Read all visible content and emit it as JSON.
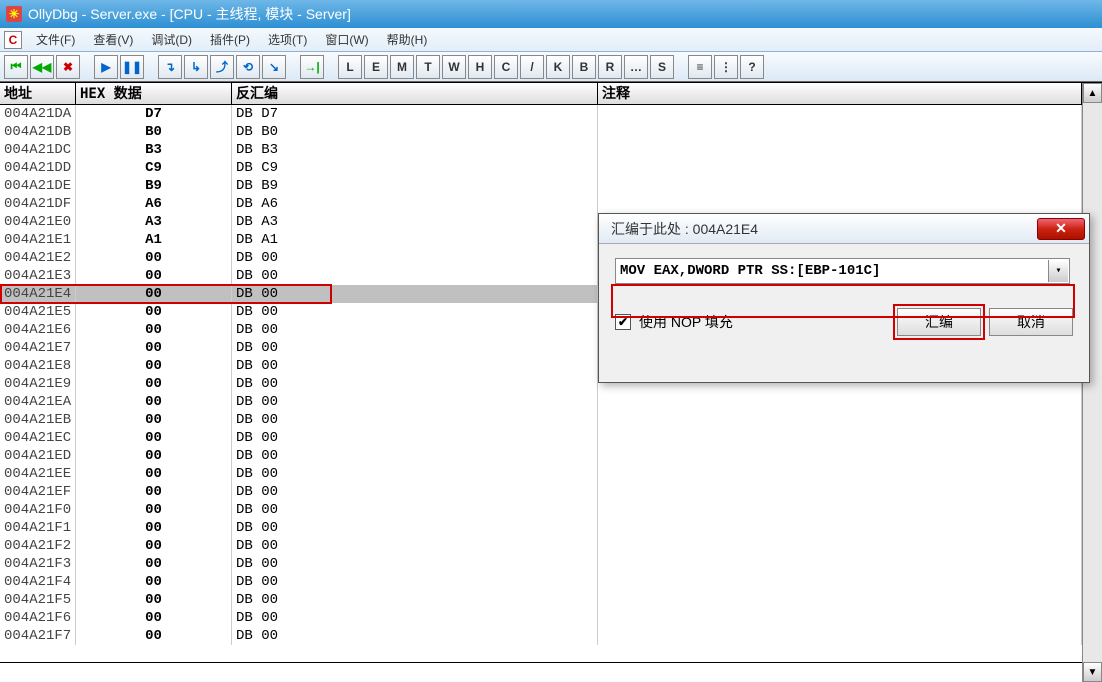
{
  "window": {
    "title": "OllyDbg - Server.exe - [CPU - 主线程, 模块 - Server]"
  },
  "menu": {
    "items": [
      "文件(F)",
      "查看(V)",
      "调试(D)",
      "插件(P)",
      "选项(T)",
      "窗口(W)",
      "帮助(H)"
    ]
  },
  "toolbar": {
    "nav": [
      "⏮",
      "◀◀",
      "✖"
    ],
    "run": [
      "▶",
      "❚❚"
    ],
    "step": [
      "↴",
      "↳",
      "⤴",
      "⟲",
      "↘"
    ],
    "goto": [
      "→|"
    ],
    "letters": [
      "L",
      "E",
      "M",
      "T",
      "W",
      "H",
      "C",
      "/",
      "K",
      "B",
      "R",
      "…",
      "S"
    ],
    "extra": [
      "≡",
      "⋮",
      "?"
    ]
  },
  "columns": {
    "addr": "地址",
    "hex": "HEX 数据",
    "disas": "反汇编",
    "comm": "注释"
  },
  "selected_addr": "004A21E4",
  "rows": [
    {
      "addr": "004A21DA",
      "hex": "D7",
      "disas": "DB D7"
    },
    {
      "addr": "004A21DB",
      "hex": "B0",
      "disas": "DB B0"
    },
    {
      "addr": "004A21DC",
      "hex": "B3",
      "disas": "DB B3"
    },
    {
      "addr": "004A21DD",
      "hex": "C9",
      "disas": "DB C9"
    },
    {
      "addr": "004A21DE",
      "hex": "B9",
      "disas": "DB B9"
    },
    {
      "addr": "004A21DF",
      "hex": "A6",
      "disas": "DB A6"
    },
    {
      "addr": "004A21E0",
      "hex": "A3",
      "disas": "DB A3"
    },
    {
      "addr": "004A21E1",
      "hex": "A1",
      "disas": "DB A1"
    },
    {
      "addr": "004A21E2",
      "hex": "00",
      "disas": "DB 00"
    },
    {
      "addr": "004A21E3",
      "hex": "00",
      "disas": "DB 00"
    },
    {
      "addr": "004A21E4",
      "hex": "00",
      "disas": "DB 00"
    },
    {
      "addr": "004A21E5",
      "hex": "00",
      "disas": "DB 00"
    },
    {
      "addr": "004A21E6",
      "hex": "00",
      "disas": "DB 00"
    },
    {
      "addr": "004A21E7",
      "hex": "00",
      "disas": "DB 00"
    },
    {
      "addr": "004A21E8",
      "hex": "00",
      "disas": "DB 00"
    },
    {
      "addr": "004A21E9",
      "hex": "00",
      "disas": "DB 00"
    },
    {
      "addr": "004A21EA",
      "hex": "00",
      "disas": "DB 00"
    },
    {
      "addr": "004A21EB",
      "hex": "00",
      "disas": "DB 00"
    },
    {
      "addr": "004A21EC",
      "hex": "00",
      "disas": "DB 00"
    },
    {
      "addr": "004A21ED",
      "hex": "00",
      "disas": "DB 00"
    },
    {
      "addr": "004A21EE",
      "hex": "00",
      "disas": "DB 00"
    },
    {
      "addr": "004A21EF",
      "hex": "00",
      "disas": "DB 00"
    },
    {
      "addr": "004A21F0",
      "hex": "00",
      "disas": "DB 00"
    },
    {
      "addr": "004A21F1",
      "hex": "00",
      "disas": "DB 00"
    },
    {
      "addr": "004A21F2",
      "hex": "00",
      "disas": "DB 00"
    },
    {
      "addr": "004A21F3",
      "hex": "00",
      "disas": "DB 00"
    },
    {
      "addr": "004A21F4",
      "hex": "00",
      "disas": "DB 00"
    },
    {
      "addr": "004A21F5",
      "hex": "00",
      "disas": "DB 00"
    },
    {
      "addr": "004A21F6",
      "hex": "00",
      "disas": "DB 00"
    },
    {
      "addr": "004A21F7",
      "hex": "00",
      "disas": "DB 00"
    }
  ],
  "dialog": {
    "title": "汇编于此处 : 004A21E4",
    "instruction": "MOV EAX,DWORD PTR SS:[EBP-101C]",
    "fill_nop_label": "使用 NOP 填充",
    "fill_nop_checked": true,
    "assemble_label": "汇编",
    "cancel_label": "取消"
  },
  "glyphs": {
    "close_x": "✕",
    "dropdown": "▾",
    "check": "✔",
    "up": "▲",
    "down": "▼"
  }
}
